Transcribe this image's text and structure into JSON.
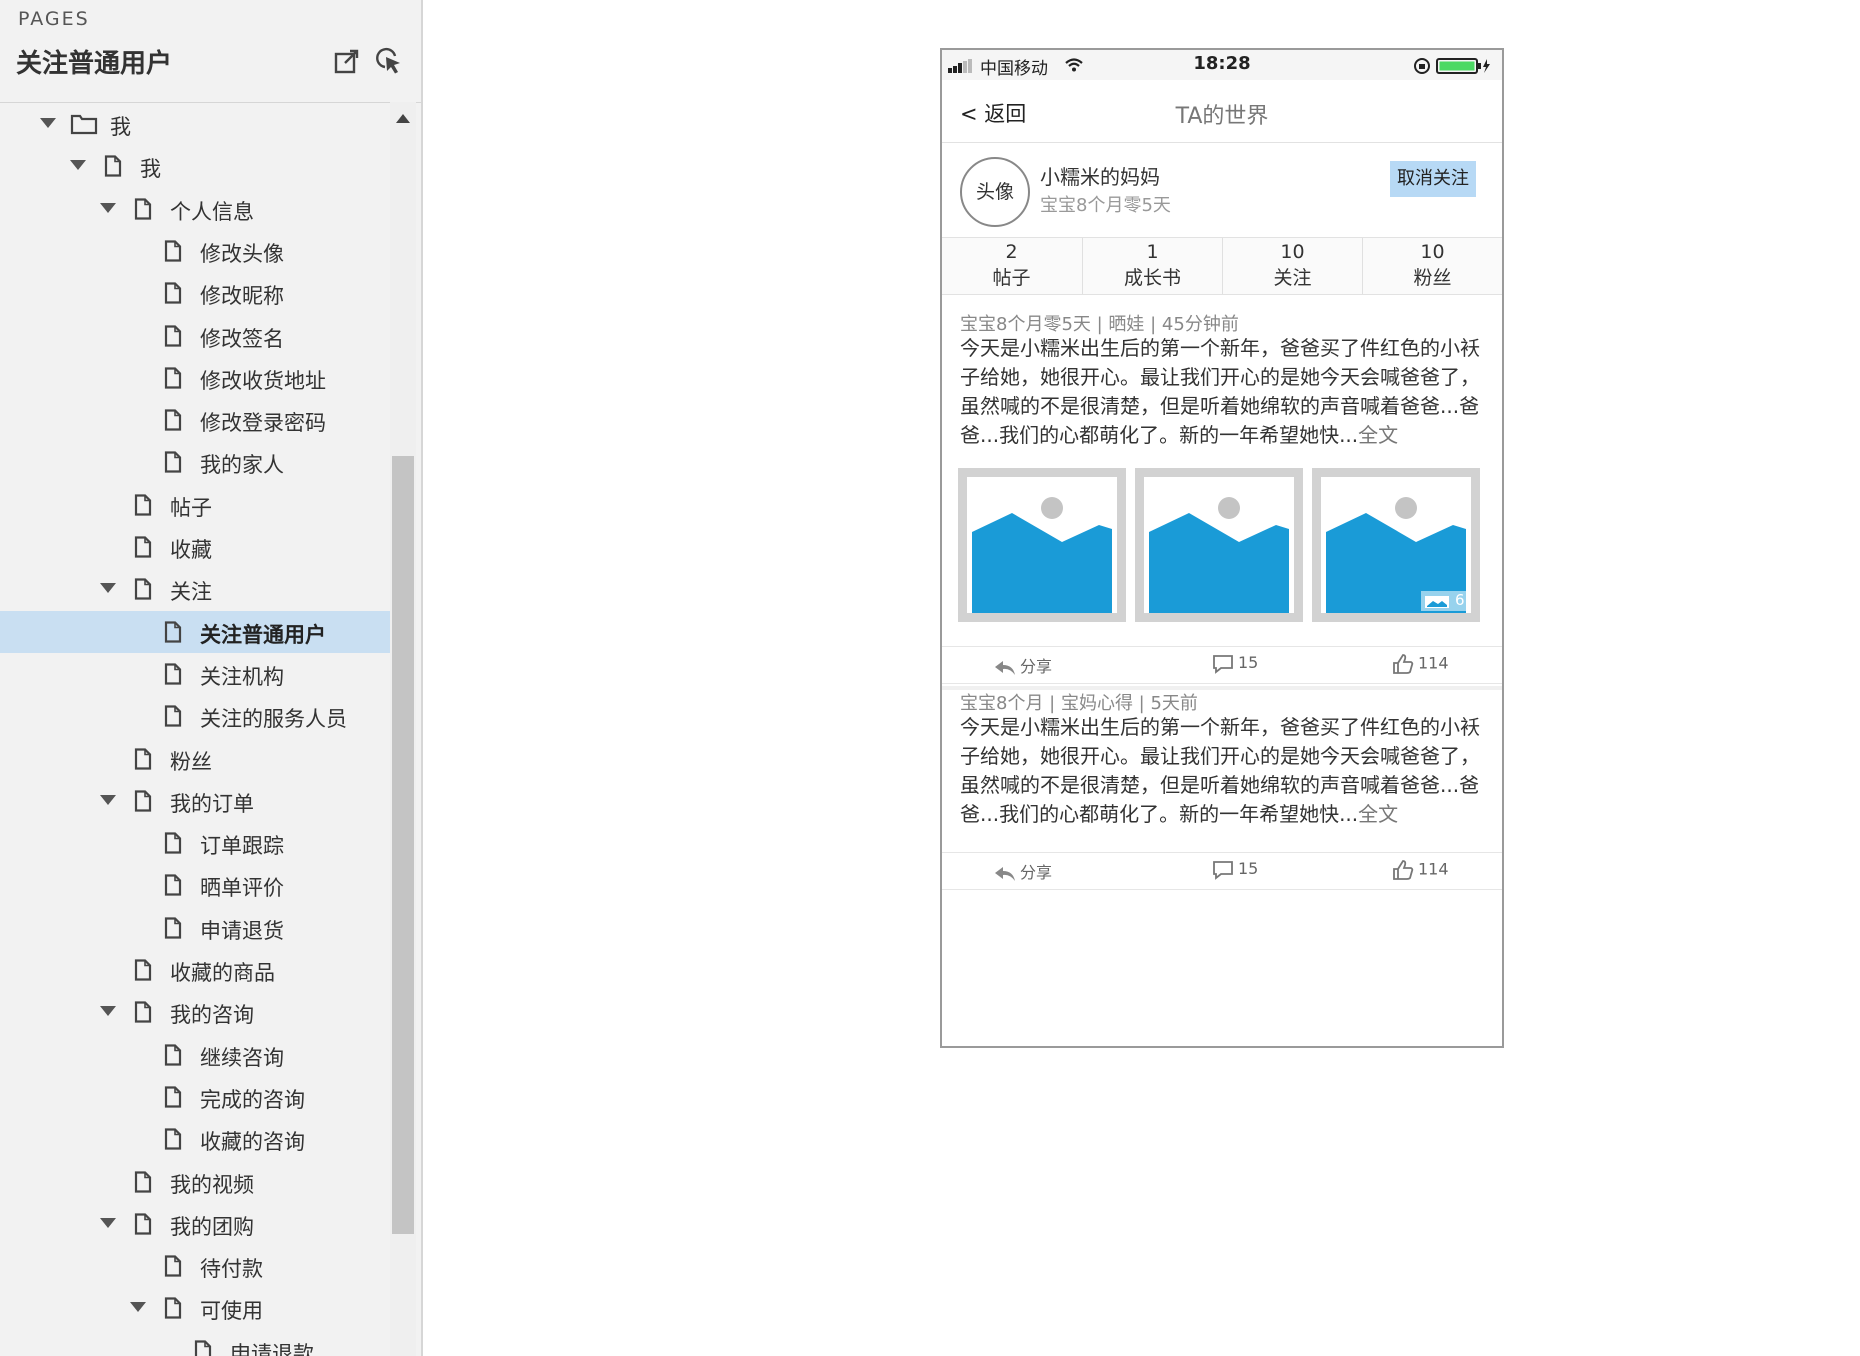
{
  "panel": {
    "caption": "PAGES",
    "title": "关注普通用户"
  },
  "tree": {
    "items": [
      {
        "label": "我",
        "level": 0,
        "icon": "folder",
        "expanded": true,
        "selected": false
      },
      {
        "label": "我",
        "level": 1,
        "icon": "page",
        "expanded": true,
        "selected": false
      },
      {
        "label": "个人信息",
        "level": 2,
        "icon": "page",
        "expanded": true,
        "selected": false
      },
      {
        "label": "修改头像",
        "level": 3,
        "icon": "page",
        "expanded": false,
        "selected": false
      },
      {
        "label": "修改昵称",
        "level": 3,
        "icon": "page",
        "expanded": false,
        "selected": false
      },
      {
        "label": "修改签名",
        "level": 3,
        "icon": "page",
        "expanded": false,
        "selected": false
      },
      {
        "label": "修改收货地址",
        "level": 3,
        "icon": "page",
        "expanded": false,
        "selected": false
      },
      {
        "label": "修改登录密码",
        "level": 3,
        "icon": "page",
        "expanded": false,
        "selected": false
      },
      {
        "label": "我的家人",
        "level": 3,
        "icon": "page",
        "expanded": false,
        "selected": false
      },
      {
        "label": "帖子",
        "level": 2,
        "icon": "page",
        "expanded": false,
        "selected": false
      },
      {
        "label": "收藏",
        "level": 2,
        "icon": "page",
        "expanded": false,
        "selected": false
      },
      {
        "label": "关注",
        "level": 2,
        "icon": "page",
        "expanded": true,
        "selected": false
      },
      {
        "label": "关注普通用户",
        "level": 3,
        "icon": "page",
        "expanded": false,
        "selected": true
      },
      {
        "label": "关注机构",
        "level": 3,
        "icon": "page",
        "expanded": false,
        "selected": false
      },
      {
        "label": "关注的服务人员",
        "level": 3,
        "icon": "page",
        "expanded": false,
        "selected": false
      },
      {
        "label": "粉丝",
        "level": 2,
        "icon": "page",
        "expanded": false,
        "selected": false
      },
      {
        "label": "我的订单",
        "level": 2,
        "icon": "page",
        "expanded": true,
        "selected": false
      },
      {
        "label": "订单跟踪",
        "level": 3,
        "icon": "page",
        "expanded": false,
        "selected": false
      },
      {
        "label": "晒单评价",
        "level": 3,
        "icon": "page",
        "expanded": false,
        "selected": false
      },
      {
        "label": "申请退货",
        "level": 3,
        "icon": "page",
        "expanded": false,
        "selected": false
      },
      {
        "label": "收藏的商品",
        "level": 2,
        "icon": "page",
        "expanded": false,
        "selected": false
      },
      {
        "label": "我的咨询",
        "level": 2,
        "icon": "page",
        "expanded": true,
        "selected": false
      },
      {
        "label": "继续咨询",
        "level": 3,
        "icon": "page",
        "expanded": false,
        "selected": false
      },
      {
        "label": "完成的咨询",
        "level": 3,
        "icon": "page",
        "expanded": false,
        "selected": false
      },
      {
        "label": "收藏的咨询",
        "level": 3,
        "icon": "page",
        "expanded": false,
        "selected": false
      },
      {
        "label": "我的视频",
        "level": 2,
        "icon": "page",
        "expanded": false,
        "selected": false
      },
      {
        "label": "我的团购",
        "level": 2,
        "icon": "page",
        "expanded": true,
        "selected": false
      },
      {
        "label": "待付款",
        "level": 3,
        "icon": "page",
        "expanded": false,
        "selected": false
      },
      {
        "label": "可使用",
        "level": 3,
        "icon": "page",
        "expanded": true,
        "selected": false
      },
      {
        "label": "申请退款",
        "level": 4,
        "icon": "page",
        "expanded": false,
        "selected": false
      }
    ]
  },
  "phone": {
    "status": {
      "carrier": "中国移动",
      "time": "18:28"
    },
    "nav": {
      "back": "< 返回",
      "title": "TA的世界"
    },
    "profile": {
      "avatar": "头像",
      "name": "小糯米的妈妈",
      "subtitle": "宝宝8个月零5天",
      "unfollow": "取消关注"
    },
    "stats": [
      {
        "num": "2",
        "label": "帖子"
      },
      {
        "num": "1",
        "label": "成长书"
      },
      {
        "num": "10",
        "label": "关注"
      },
      {
        "num": "10",
        "label": "粉丝"
      }
    ],
    "posts": [
      {
        "meta": "宝宝8个月零5天 |  晒娃  |  45分钟前",
        "text": "今天是小糯米出生后的第一个新年，爸爸买了件红色的小袄子给她，她很开心。最让我们开心的是她今天会喊爸爸了，虽然喊的不是很清楚，但是听着她绵软的声音喊着爸爸...爸爸...我们的心都萌化了。新的一年希望她快...",
        "fulltext": "全文",
        "photo_count": "6",
        "share": "分享",
        "comments": "15",
        "likes": "114"
      },
      {
        "meta": "宝宝8个月 |  宝妈心得  |  5天前",
        "text": "今天是小糯米出生后的第一个新年，爸爸买了件红色的小袄子给她，她很开心。最让我们开心的是她今天会喊爸爸了，虽然喊的不是很清楚，但是听着她绵软的声音喊着爸爸...爸爸...我们的心都萌化了。新的一年希望她快...",
        "fulltext": "全文",
        "share": "分享",
        "comments": "15",
        "likes": "114"
      }
    ]
  },
  "colors": {
    "selection": "#c9dff2",
    "unfollow_bg": "#b7d9f5",
    "image_blue": "#1a9bd7",
    "battery_green": "#4cd964"
  }
}
